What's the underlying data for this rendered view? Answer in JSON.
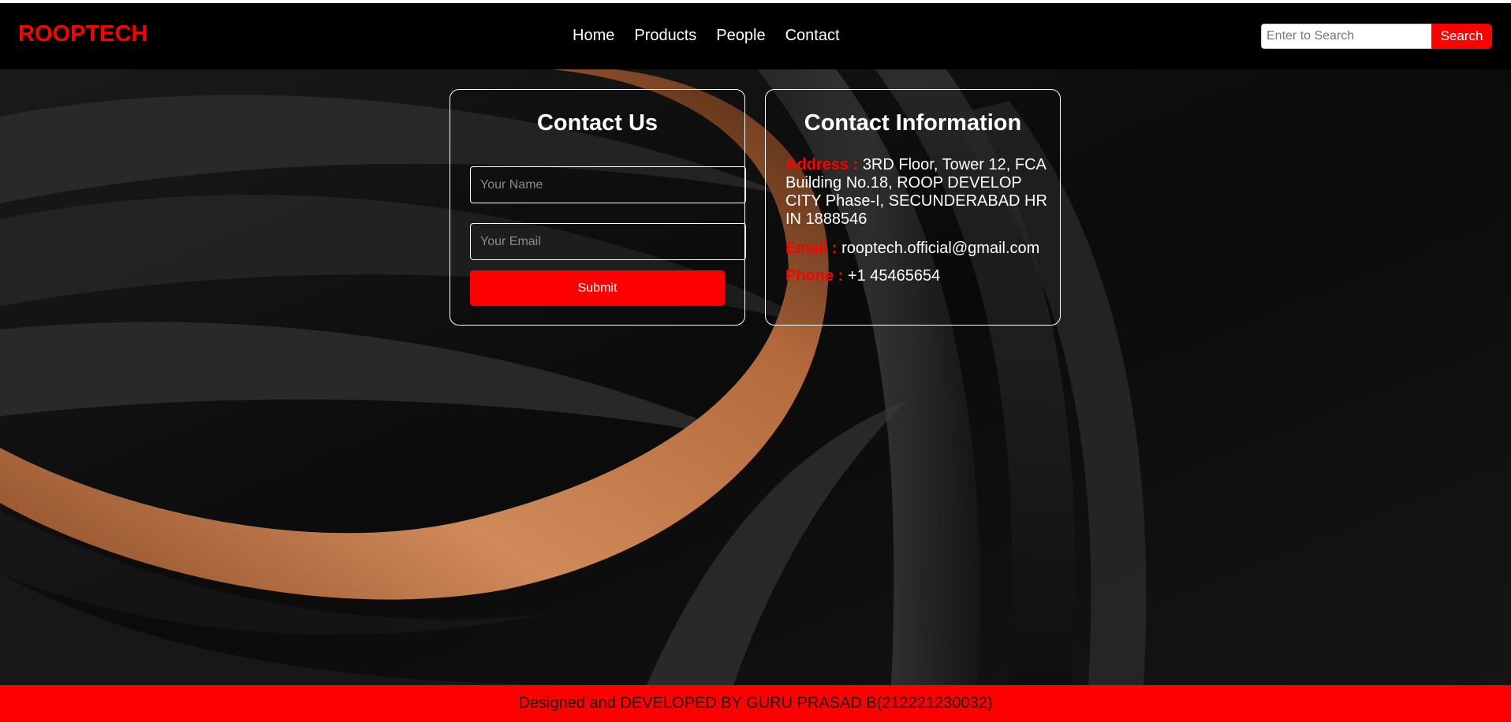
{
  "nav": {
    "brand": "ROOPTECH",
    "links": [
      "Home",
      "Products",
      "People",
      "Contact"
    ],
    "search_placeholder": "Enter to Search",
    "search_button": "Search"
  },
  "contact_form": {
    "title": "Contact Us",
    "name_placeholder": "Your Name",
    "email_placeholder": "Your Email",
    "submit_label": "Submit"
  },
  "contact_info": {
    "title": "Contact Information",
    "address_label": "Address :",
    "address_value": "3RD Floor, Tower 12, FCA Building No.18, ROOP DEVELOP CITY Phase-I, SECUNDERABAD HR IN 1888546",
    "email_label": "Email :",
    "email_value": "rooptech.official@gmail.com",
    "phone_label": "Phone :",
    "phone_value": "+1 45465654"
  },
  "footer": {
    "text": "Designed and DEVELOPED BY GURU PRASAD B(212221230032)"
  },
  "colors": {
    "accent": "#ff0000",
    "navbar_bg": "#000000",
    "text": "#ffffff"
  }
}
